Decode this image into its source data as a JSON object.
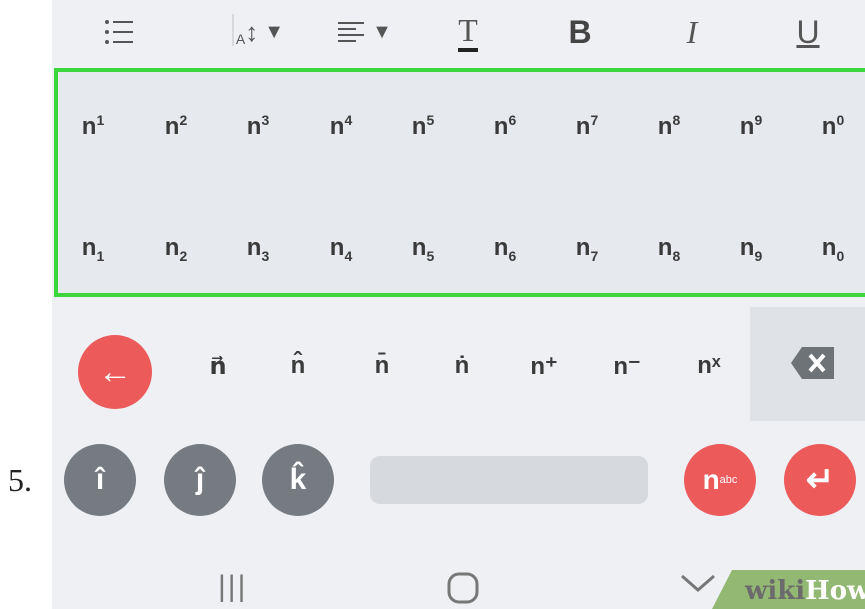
{
  "step_number": "5.",
  "toolbar": {
    "list_icon": "list-icon",
    "font_size_icon": "font-size-icon",
    "align_icon": "align-icon",
    "text_color_glyph": "T",
    "bold_glyph": "B",
    "italic_glyph": "I",
    "underline_glyph": "U",
    "font_size_label": "A",
    "font_size_arrow": "↕",
    "dropdown_arrow": "▼"
  },
  "superscript_row": [
    {
      "base": "n",
      "sup": "1"
    },
    {
      "base": "n",
      "sup": "2"
    },
    {
      "base": "n",
      "sup": "3"
    },
    {
      "base": "n",
      "sup": "4"
    },
    {
      "base": "n",
      "sup": "5"
    },
    {
      "base": "n",
      "sup": "6"
    },
    {
      "base": "n",
      "sup": "7"
    },
    {
      "base": "n",
      "sup": "8"
    },
    {
      "base": "n",
      "sup": "9"
    },
    {
      "base": "n",
      "sup": "0"
    }
  ],
  "subscript_row": [
    {
      "base": "n",
      "sub": "1"
    },
    {
      "base": "n",
      "sub": "2"
    },
    {
      "base": "n",
      "sub": "3"
    },
    {
      "base": "n",
      "sub": "4"
    },
    {
      "base": "n",
      "sub": "5"
    },
    {
      "base": "n",
      "sub": "6"
    },
    {
      "base": "n",
      "sub": "7"
    },
    {
      "base": "n",
      "sub": "8"
    },
    {
      "base": "n",
      "sub": "9"
    },
    {
      "base": "n",
      "sub": "0"
    }
  ],
  "accent_keys": [
    "n⃗",
    "n̂",
    "n̄",
    "ṅ",
    "n⁺",
    "n⁻",
    "nˣ"
  ],
  "vector_keys": [
    "î",
    "ĵ",
    "k̂"
  ],
  "back_glyph": "←",
  "enter_glyph": "↵",
  "backspace_glyph": "✕",
  "format_key": {
    "base": "n",
    "sup": "abc"
  },
  "navbar": {
    "recent": "|||",
    "home": "○",
    "back": "✓"
  },
  "watermark": {
    "wiki": "wiki",
    "how": "How"
  },
  "colors": {
    "selection_border": "#3ad63a",
    "red_key": "#ec5a5a",
    "gray_key": "#757b80",
    "panel_bg": "#eef0f4"
  }
}
